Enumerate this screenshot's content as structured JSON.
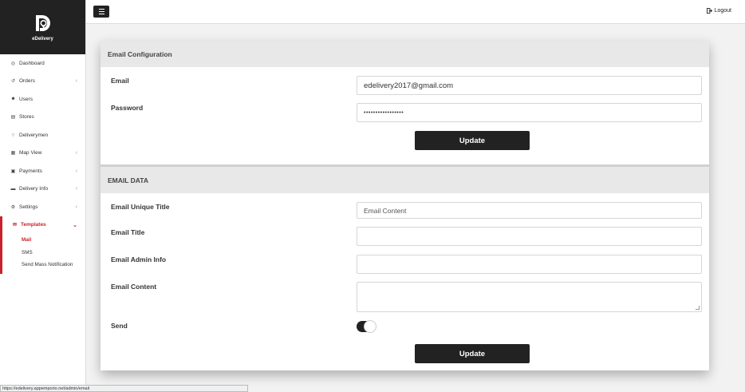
{
  "brand": {
    "name": "eDelivery"
  },
  "sidebar": {
    "items": [
      {
        "label": "Dashboard",
        "icon": "dashboard-icon",
        "glyph": "◎",
        "chevron": false
      },
      {
        "label": "Orders",
        "icon": "history-icon",
        "glyph": "↺",
        "chevron": true
      },
      {
        "label": "Users",
        "icon": "user-icon",
        "glyph": "☻",
        "chevron": false
      },
      {
        "label": "Stores",
        "icon": "building-icon",
        "glyph": "▤",
        "chevron": false
      },
      {
        "label": "Deliverymen",
        "icon": "motorcycle-icon",
        "glyph": "∵",
        "chevron": false
      },
      {
        "label": "Map View",
        "icon": "map-icon",
        "glyph": "▦",
        "chevron": true
      },
      {
        "label": "Payments",
        "icon": "money-icon",
        "glyph": "▣",
        "chevron": true
      },
      {
        "label": "Delivery Info",
        "icon": "truck-icon",
        "glyph": "▬",
        "chevron": true
      },
      {
        "label": "Settings",
        "icon": "gear-icon",
        "glyph": "⚙",
        "chevron": true
      }
    ],
    "templates": {
      "label": "Templates",
      "icon": "envelope-icon",
      "glyph": "✉",
      "children": [
        "Mail",
        "SMS",
        "Send Mass Notification"
      ]
    }
  },
  "topbar": {
    "logout_label": "Logout"
  },
  "email_config": {
    "heading": "Email Configuration",
    "email_label": "Email",
    "email_value": "edelivery2017@gmail.com",
    "password_label": "Password",
    "password_value": "•••••••••••••••••",
    "update_label": "Update"
  },
  "email_data": {
    "heading": "EMAIL DATA",
    "unique_title_label": "Email Unique Title",
    "unique_title_value": "Email Content",
    "title_label": "Email Title",
    "title_value": "",
    "admin_info_label": "Email Admin Info",
    "admin_info_value": "",
    "content_label": "Email Content",
    "content_value": "",
    "send_label": "Send",
    "send_enabled": true,
    "update_label": "Update"
  },
  "status_bar": {
    "url": "https://edelivery.appemporio.net/admin/email"
  },
  "colors": {
    "accent": "#c8232c",
    "dark": "#222222",
    "section_bg": "#e8e8e8"
  }
}
